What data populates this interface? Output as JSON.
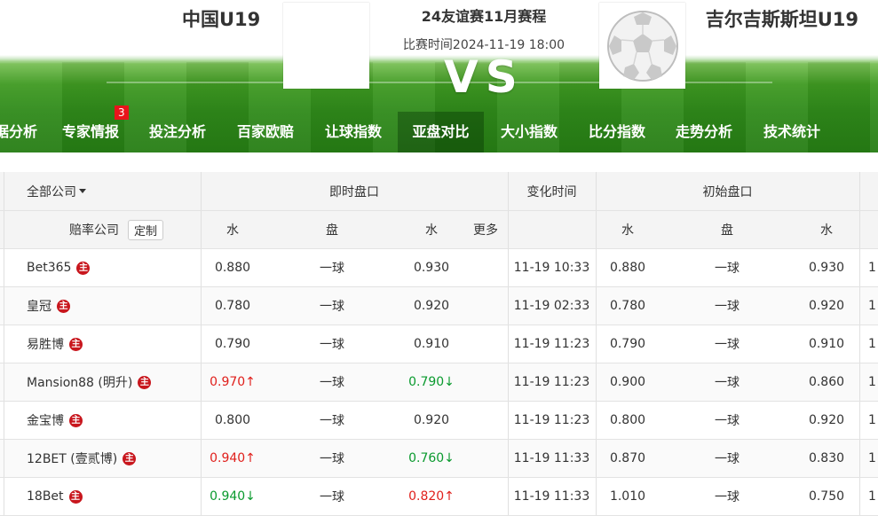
{
  "header": {
    "home_team": "中国U19",
    "away_team": "吉尔吉斯斯坦U19",
    "match_title": "24友谊赛11月赛程",
    "match_time": "比赛时间2024-11-19 18:00",
    "vs": "VS"
  },
  "nav": {
    "items": [
      {
        "label": "据分析"
      },
      {
        "label": "专家情报",
        "badge": "3"
      },
      {
        "label": "投注分析"
      },
      {
        "label": "百家欧赔"
      },
      {
        "label": "让球指数"
      },
      {
        "label": "亚盘对比"
      },
      {
        "label": "大小指数"
      },
      {
        "label": "比分指数"
      },
      {
        "label": "走势分析"
      },
      {
        "label": "技术统计"
      }
    ],
    "active": "亚盘对比"
  },
  "table": {
    "all_companies": "全部公司",
    "live_group": "即时盘口",
    "change_time": "变化时间",
    "initial_group": "初始盘口",
    "company_label": "赔率公司",
    "custom_btn": "定制",
    "water": "水",
    "handicap": "盘",
    "more": "更多",
    "rows": [
      {
        "company": "Bet365",
        "lw1": "0.880",
        "lh": "一球",
        "lw2": "0.930",
        "time": "11-19 10:33",
        "iw1": "0.880",
        "ih": "一球",
        "iw2": "0.930",
        "extra": "1"
      },
      {
        "company": "皇冠",
        "lw1": "0.780",
        "lh": "一球",
        "lw2": "0.920",
        "time": "11-19 02:33",
        "iw1": "0.780",
        "ih": "一球",
        "iw2": "0.920",
        "extra": "1"
      },
      {
        "company": "易胜博",
        "lw1": "0.790",
        "lh": "一球",
        "lw2": "0.910",
        "time": "11-19 11:23",
        "iw1": "0.790",
        "ih": "一球",
        "iw2": "0.910",
        "extra": "1"
      },
      {
        "company": "Mansion88 (明升)",
        "lw1": "0.970↑",
        "lw1_dir": "up",
        "lh": "一球",
        "lw2": "0.790↓",
        "lw2_dir": "down",
        "time": "11-19 11:23",
        "iw1": "0.900",
        "ih": "一球",
        "iw2": "0.860",
        "extra": "1"
      },
      {
        "company": "金宝博",
        "lw1": "0.800",
        "lh": "一球",
        "lw2": "0.920",
        "time": "11-19 11:23",
        "iw1": "0.800",
        "ih": "一球",
        "iw2": "0.920",
        "extra": "1"
      },
      {
        "company": "12BET (壹贰博)",
        "lw1": "0.940↑",
        "lw1_dir": "up",
        "lh": "一球",
        "lw2": "0.760↓",
        "lw2_dir": "down",
        "time": "11-19 11:33",
        "iw1": "0.870",
        "ih": "一球",
        "iw2": "0.830",
        "extra": "1"
      },
      {
        "company": "18Bet",
        "lw1": "0.940↓",
        "lw1_dir": "down",
        "lh": "一球",
        "lw2": "0.820↑",
        "lw2_dir": "up",
        "time": "11-19 11:33",
        "iw1": "1.010",
        "ih": "一球",
        "iw2": "0.750",
        "extra": "1"
      }
    ]
  },
  "icons": {
    "zhu": "主"
  },
  "colors": {
    "up": "#e0201c",
    "down": "#0a9a2e",
    "badge": "#e8141b",
    "pitch": "#3f9a22"
  }
}
